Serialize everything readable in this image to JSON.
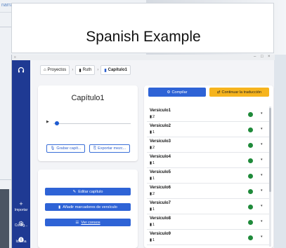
{
  "header": {
    "title": "Spanish Example"
  },
  "background": {
    "snippet": "narrator"
  },
  "window": {
    "minimize": "–",
    "maximize": "□",
    "close": "×",
    "menu": "≡"
  },
  "breadcrumb": {
    "home_icon": "home-icon",
    "items": [
      {
        "label": "Proyectos"
      },
      {
        "label": "Ruth"
      },
      {
        "label": "Capítulo1"
      }
    ],
    "separator": "›"
  },
  "sidebar": {
    "items": [
      {
        "label": "Importar",
        "icon": "plus-icon"
      },
      {
        "label": "Config...",
        "icon": "gear-icon"
      },
      {
        "label": "Idioma",
        "icon": "info-icon"
      }
    ]
  },
  "chapter": {
    "title": "Capítulo1",
    "record_label": "Grabar capít...",
    "export_label": "Exportar mezc...",
    "edit_label": "Editar capítulo",
    "add_markers_label": "Añadir marcadores de versículo",
    "versions_label": "Ver consos"
  },
  "actions": {
    "compile_label": "Compilar",
    "publish_label": "Continuar la traducción"
  },
  "verses": [
    {
      "name": "Versículo1",
      "count": "2"
    },
    {
      "name": "Versículo2",
      "count": "1"
    },
    {
      "name": "Versículo3",
      "count": "2"
    },
    {
      "name": "Versículo4",
      "count": "1"
    },
    {
      "name": "Versículo5",
      "count": "1"
    },
    {
      "name": "Versículo6",
      "count": "2"
    },
    {
      "name": "Versículo7",
      "count": "1"
    },
    {
      "name": "Versículo8",
      "count": "1"
    },
    {
      "name": "Versículo9",
      "count": "1"
    }
  ],
  "colors": {
    "sidebar": "#1f3a93",
    "primary": "#2e63d6",
    "accent": "#f6b41d",
    "status": "#1f8a3a"
  }
}
